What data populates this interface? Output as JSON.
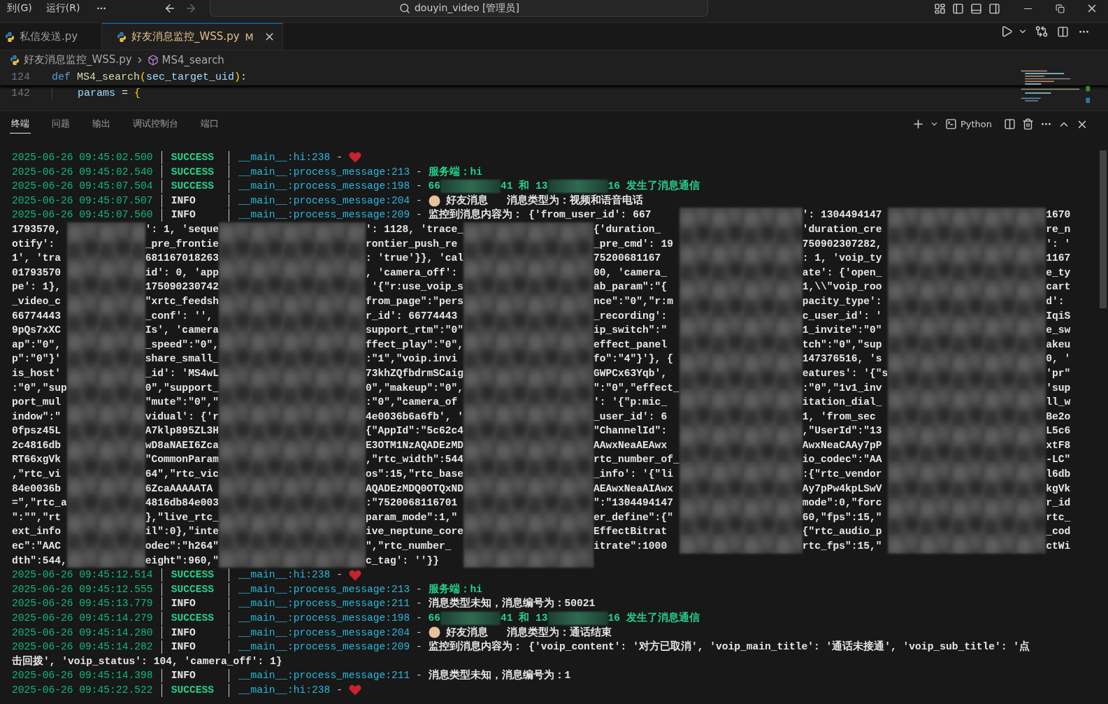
{
  "menu": [
    {
      "label": "到(G)"
    },
    {
      "label": "运行(R)"
    }
  ],
  "nav": {
    "back": {
      "disabled": false
    },
    "forward": {
      "disabled": true
    }
  },
  "command_center": {
    "text": "douyin_video [管理员]"
  },
  "editor_tabs": [
    {
      "label": "私信发送.py",
      "selected": false
    },
    {
      "label": "好友消息监控_WSS.py",
      "selected": true,
      "badge": "M"
    }
  ],
  "breadcrumb": [
    {
      "kind": "file",
      "label": "好友消息监控_WSS.py"
    },
    {
      "kind": "symbol",
      "label": "MS4_search"
    }
  ],
  "code_lines": [
    {
      "number": "124",
      "indented": false,
      "tokens": [
        {
          "kind": "keyword",
          "text": "def "
        },
        {
          "kind": "function",
          "text": "MS4_search"
        },
        {
          "kind": "brace",
          "text": "("
        },
        {
          "kind": "variable",
          "text": "sec_target_uid"
        },
        {
          "kind": "brace",
          "text": ")"
        },
        {
          "kind": "plain",
          "text": ":"
        }
      ]
    },
    {
      "number": "142",
      "indented": true,
      "tokens": [
        {
          "kind": "variable",
          "text": "params"
        },
        {
          "kind": "plain",
          "text": " = "
        },
        {
          "kind": "brace",
          "text": "{"
        }
      ]
    }
  ],
  "panel_tabs": [
    {
      "label": "终端",
      "selected": true
    },
    {
      "label": "问题",
      "selected": false
    },
    {
      "label": "输出",
      "selected": false
    },
    {
      "label": "调试控制台",
      "selected": false
    },
    {
      "label": "端口",
      "selected": false
    }
  ],
  "terminal_profile": "Python",
  "terminal": [
    {
      "kind": "log",
      "time": "2025-06-26 09:45:02.500",
      "level": "SUCCESS",
      "source": "__main__:hi:238",
      "dash": "-",
      "message": [
        {
          "kind": "heart"
        }
      ]
    },
    {
      "kind": "log",
      "time": "2025-06-26 09:45:02.540",
      "level": "SUCCESS",
      "source": "__main__:process_message:213",
      "dash": "-",
      "message": [
        {
          "kind": "text",
          "text": "服务端：hi"
        }
      ]
    },
    {
      "kind": "log",
      "time": "2025-06-26 09:45:07.504",
      "level": "SUCCESS",
      "source": "__main__:process_message:198",
      "dash": "-",
      "message": [
        {
          "kind": "text",
          "text": "66"
        },
        {
          "kind": "redacted"
        },
        {
          "kind": "text",
          "text": "41 和 13"
        },
        {
          "kind": "redacted"
        },
        {
          "kind": "text",
          "text": "16 发生了消息通信"
        }
      ]
    },
    {
      "kind": "log",
      "time": "2025-06-26 09:45:07.507",
      "level": "INFO",
      "source": "__main__:process_message:204",
      "dash": "-",
      "message": [
        {
          "kind": "face"
        },
        {
          "kind": "text",
          "text": " 好友消息   消息类型为：视频和语音电话"
        }
      ]
    },
    {
      "kind": "redacted_block",
      "head": {
        "time": "2025-06-26 09:45:07.560",
        "level": "INFO",
        "source": "__main__:process_message:209",
        "dash": "-",
        "message": [
          {
            "kind": "text",
            "text": "监控到消息内容为： {'from_user_id': 667"
          }
        ]
      },
      "head_tail": [
        "': 1304494147",
        "1670"
      ],
      "rows": [
        [
          "1793570,",
          "': 1, 'seque",
          "': 1128, 'trace_",
          "{'duration_",
          "'duration_cre",
          "re_n"
        ],
        [
          "otify':",
          "_pre_frontie",
          "rontier_push_re",
          "_pre_cmd': 19",
          "750902307282,",
          "': '"
        ],
        [
          "1', 'tra",
          "681167018263",
          ": 'true'}}, 'cal",
          "75200681167",
          ": 1, 'voip_ty",
          "1167"
        ],
        [
          "01793570",
          "id': 0, 'app",
          ", 'camera_off':",
          "00, 'camera_",
          "ate': {'open_",
          "e_ty"
        ],
        [
          "pe': 1},",
          "175090230742",
          " '{\"r:use_voip_s",
          "ab_param\":\"{",
          "1,\\\\\"voip_roo",
          "cart"
        ],
        [
          "_video_c",
          "\"xrtc_feedsh",
          "from_page\":\"pers",
          "nce\":\"0\",\"r:m",
          "pacity_type':",
          "d':"
        ],
        [
          "66774443",
          "_conf': '',",
          "r_id': 66774443",
          "_recording':",
          "c_user_id': '",
          "IqiS"
        ],
        [
          "9pQs7xXC",
          "Is', 'camera",
          "support_rtm\":\"0\"",
          "ip_switch\":\"",
          "1_invite\":\"0\"",
          "e_sw"
        ],
        [
          "ap\":\"0\",",
          "_speed\":\"0\",",
          "ffect_play\":\"0\",",
          "effect_panel",
          "tch\":\"0\",\"sup",
          "akeu"
        ],
        [
          "p\":\"0\"}'",
          "share_small_",
          ":\"1\",\"voip.invi",
          "fo\":\"4\"}'}, {",
          "147376516, 's",
          "0, '"
        ],
        [
          "is_host'",
          "_id': 'MS4wL",
          "73khZQfbdrmSCaig",
          "GWPCx63Yqb',",
          "eatures': '{\"s",
          "'pr\""
        ],
        [
          ":\"0\",\"sup",
          "0\",\"support_",
          "0\",\"makeup\":\"0\",",
          "\":\"0\",\"effect_",
          ":\"0\",\"1v1_inv",
          "'sup"
        ],
        [
          "port_mul",
          "\"mute\":\"0\",\"",
          ":\"0\",\"camera_of",
          "': '{\"p:mic_",
          "itation_dial_",
          "ll_w"
        ],
        [
          "indow\":\"",
          "vidual': {'r",
          "4e0036b6a6fb', '",
          "_user_id': 6",
          "1, 'from_sec",
          "Be2o"
        ],
        [
          "0fpsz45L",
          "A7klp895ZL3H",
          "{\"AppId\":\"5c62c4",
          "\"ChannelId\":",
          ",\"UserId\":\"13",
          "L5c6"
        ],
        [
          "2c4816db",
          "wD8aNAEI6Zca",
          "E3OTM1NzAQADEzMD",
          "AAwxNeaAEAwx",
          "AwxNeaCAAy7pP",
          "xtF8"
        ],
        [
          "RT66xgVk",
          "\"CommonParam",
          ",\"rtc_width\":544",
          "rtc_number_of_",
          "io_codec\":\"AA",
          "-LC\""
        ],
        [
          ",\"rtc_vi",
          "64\",\"rtc_vic",
          "os\":15,\"rtc_base",
          "_info': '{\"li",
          ":{\"rtc_vendor",
          "l6db"
        ],
        [
          "84e0036b",
          "6ZcaAAAAATA",
          "AQADEzMDQ0OTQxND",
          "AEAwxNeaAIAwx",
          "Ay7pPw4kpLSwV",
          "kgVk"
        ],
        [
          "=\",\"rtc_a",
          "4816db84e003",
          ":\"7520068116701",
          "\":\"1304494147",
          "mode\":0,\"forc",
          "r_id"
        ],
        [
          "\":\"\",\"rt",
          "},\"live_rtc_",
          "param_mode\":1,\"",
          "er_define\":{\"",
          "60,\"fps\":15,\"",
          "rtc_"
        ],
        [
          "ext_info",
          "il\":0},\"inte",
          "ive_neptune_core",
          "EffectBitrat",
          "{\"rtc_audio_p",
          "_cod"
        ],
        [
          "ec\":\"AAC",
          "odec\":\"h264\"",
          "\",\"rtc_number_",
          "itrate\":1000",
          "rtc_fps\":15,\"",
          "ctWi"
        ],
        [
          "dth\":544,",
          "eight\":960,\"",
          "c_tag': ''}}"
        ]
      ]
    },
    {
      "kind": "log",
      "time": "2025-06-26 09:45:12.514",
      "level": "SUCCESS",
      "source": "__main__:hi:238",
      "dash": "-",
      "message": [
        {
          "kind": "heart"
        }
      ]
    },
    {
      "kind": "log",
      "time": "2025-06-26 09:45:12.555",
      "level": "SUCCESS",
      "source": "__main__:process_message:213",
      "dash": "-",
      "message": [
        {
          "kind": "text",
          "text": "服务端：hi"
        }
      ]
    },
    {
      "kind": "log",
      "time": "2025-06-26 09:45:13.779",
      "level": "INFO",
      "source": "__main__:process_message:211",
      "dash": "-",
      "message": [
        {
          "kind": "text",
          "text": "消息类型未知，消息编号为：50021"
        }
      ]
    },
    {
      "kind": "log",
      "time": "2025-06-26 09:45:14.279",
      "level": "SUCCESS",
      "source": "__main__:process_message:198",
      "dash": "-",
      "message": [
        {
          "kind": "text",
          "text": "66"
        },
        {
          "kind": "redacted"
        },
        {
          "kind": "text",
          "text": "41 和 13"
        },
        {
          "kind": "redacted"
        },
        {
          "kind": "text",
          "text": "16 发生了消息通信"
        }
      ]
    },
    {
      "kind": "log",
      "time": "2025-06-26 09:45:14.280",
      "level": "INFO",
      "source": "__main__:process_message:204",
      "dash": "-",
      "message": [
        {
          "kind": "face"
        },
        {
          "kind": "text",
          "text": " 好友消息   消息类型为：通话结束"
        }
      ]
    },
    {
      "kind": "log",
      "time": "2025-06-26 09:45:14.282",
      "level": "INFO",
      "source": "__main__:process_message:209",
      "dash": "-",
      "message": [
        {
          "kind": "text",
          "text": "监控到消息内容为： {'voip_content': '对方已取消', 'voip_main_title': '通话未接通', 'voip_sub_title': '点"
        }
      ]
    },
    {
      "kind": "wrap",
      "text": "击回拨', 'voip_status': 104, 'camera_off': 1}"
    },
    {
      "kind": "log",
      "time": "2025-06-26 09:45:14.398",
      "level": "INFO",
      "source": "__main__:process_message:211",
      "dash": "-",
      "message": [
        {
          "kind": "text",
          "text": "消息类型未知，消息编号为：1"
        }
      ]
    },
    {
      "kind": "log",
      "time": "2025-06-26 09:45:22.522",
      "level": "SUCCESS",
      "source": "__main__:hi:238",
      "dash": "-",
      "message": [
        {
          "kind": "heart"
        }
      ]
    }
  ]
}
